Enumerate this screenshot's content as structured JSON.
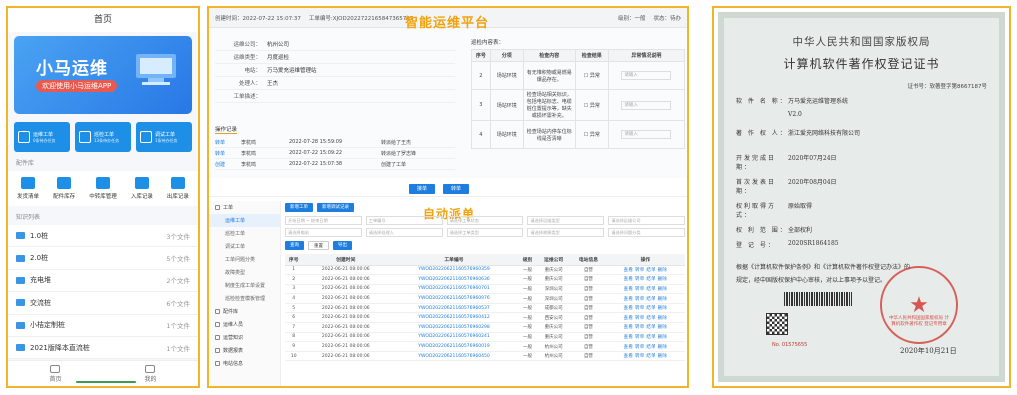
{
  "mobile": {
    "title": "首页",
    "banner_title": "小马运维",
    "banner_subtitle": "欢迎使用小马运维APP",
    "cards": [
      {
        "label": "运维工单",
        "sub": "0条待办任务"
      },
      {
        "label": "巡检工单",
        "sub": "13条待办任务"
      },
      {
        "label": "调试工单",
        "sub": "1条待办任务"
      }
    ],
    "section_parts": "配件库",
    "icons": [
      {
        "label": "发货清单"
      },
      {
        "label": "配件库存"
      },
      {
        "label": "中转库管理"
      },
      {
        "label": "入库记录"
      },
      {
        "label": "出库记录"
      }
    ],
    "section_knowledge": "知识列表",
    "knowledge": [
      {
        "name": "1.0桩",
        "count": "3个文件"
      },
      {
        "name": "2.0桩",
        "count": "5个文件"
      },
      {
        "name": "充电堆",
        "count": "2个文件"
      },
      {
        "name": "交流桩",
        "count": "6个文件"
      },
      {
        "name": "小桔定制桩",
        "count": "1个文件"
      },
      {
        "name": "2021版降本直流桩",
        "count": "1个文件"
      }
    ],
    "tabs": [
      {
        "label": "首页"
      },
      {
        "label": "我的"
      }
    ]
  },
  "web": {
    "header": {
      "created": "创建时间：2022-07-22 15:07:37",
      "order_no": "工单编号:XJOD2022722165847365792",
      "level": "级别：一般",
      "status": "状态：待办"
    },
    "title": "智能运维平台",
    "form": [
      {
        "label": "运维公司：",
        "value": "杭州公司"
      },
      {
        "label": "运维类型：",
        "value": "月度巡检"
      },
      {
        "label": "电站：",
        "value": "万马爱充运维管理站"
      },
      {
        "label": "处理人：",
        "value": "王杰"
      },
      {
        "label": "工单描述：",
        "value": ""
      }
    ],
    "check_title": "巡检内容表：",
    "check_headers": [
      "序号",
      "分项",
      "检查内容",
      "检查结果",
      "异常情况说明"
    ],
    "check_rows": [
      {
        "no": "2",
        "item": "场站环境",
        "content": "有无堆积物或易燃易爆品存在。",
        "result": "异常",
        "note": "请输入"
      },
      {
        "no": "3",
        "item": "场站环境",
        "content": "检查场站相关标识，包括电站标志、电缆桩位置提示等，缺失或损坏需补充。",
        "result": "异常",
        "note": "请输入"
      },
      {
        "no": "4",
        "item": "场站环境",
        "content": "检查场站内停车位标线是否清晰",
        "result": "异常",
        "note": "请输入"
      }
    ],
    "oplog_title": "操作记录",
    "oplog": [
      {
        "action": "转单",
        "user": "李杭鸣",
        "time": "2022-07-28 15:59:09",
        "desc": "转派给了王杰"
      },
      {
        "action": "转单",
        "user": "李杭鸣",
        "time": "2022-07-22 15:09:22",
        "desc": "转派给了罗志锋"
      },
      {
        "action": "创建",
        "user": "李杭鸣",
        "time": "2022-07-22 15:07:38",
        "desc": "创建了工单"
      }
    ],
    "btn_receive": "接单",
    "btn_transfer": "转单",
    "title2": "自动派单",
    "sidebar": [
      {
        "label": "工单",
        "type": "top"
      },
      {
        "label": "运维工单",
        "type": "sub-active"
      },
      {
        "label": "巡检工单",
        "type": "sub"
      },
      {
        "label": "调试工单",
        "type": "sub"
      },
      {
        "label": "工单问题分类",
        "type": "sub"
      },
      {
        "label": "故障类型",
        "type": "sub"
      },
      {
        "label": "制度生成工单设置",
        "type": "sub"
      },
      {
        "label": "巡检检查模板管理",
        "type": "sub"
      },
      {
        "label": "配件库",
        "type": "top"
      },
      {
        "label": "运维人员",
        "type": "top"
      },
      {
        "label": "运营知识",
        "type": "top"
      },
      {
        "label": "数据报表",
        "type": "top"
      },
      {
        "label": "电站信息",
        "type": "top"
      }
    ],
    "toolbar": [
      "新增工单",
      "新增调试记录"
    ],
    "filters": [
      "开始日期 ~ 结束日期",
      "工单编号",
      "请选择工单状态",
      "请选择运维类型",
      "请选择运维公司",
      "请选择电站",
      "请选择处理人",
      "请选择工单类型",
      "请选择故障类型",
      "请选择问题分类"
    ],
    "action_buttons": [
      "查询",
      "重置",
      "导出"
    ],
    "grid_headers": [
      "序号",
      "创建时间",
      "工单编号",
      "级别",
      "运维公司",
      "电站信息",
      "操作"
    ],
    "grid_rows": [
      {
        "no": "1",
        "time": "2022-06-21 08:00:06",
        "order": "YWOD20220621160576960359",
        "level": "一般",
        "company": "重庆公司",
        "station": "自营",
        "ops": "查看 转单 结单 删除"
      },
      {
        "no": "2",
        "time": "2022-06-21 08:00:06",
        "order": "YWOD20220621160576960636",
        "level": "一般",
        "company": "重庆公司",
        "station": "自营",
        "ops": "查看 转单 结单 删除"
      },
      {
        "no": "3",
        "time": "2022-06-21 08:00:06",
        "order": "YWOD20220621160576960701",
        "level": "一般",
        "company": "深圳公司",
        "station": "自营",
        "ops": "查看 转单 结单 删除"
      },
      {
        "no": "4",
        "time": "2022-06-21 08:00:06",
        "order": "YWOD20220621160576960976",
        "level": "一般",
        "company": "深圳公司",
        "station": "自营",
        "ops": "查看 转单 结单 删除"
      },
      {
        "no": "5",
        "time": "2022-06-21 08:00:06",
        "order": "YWOD20220621160576960537",
        "level": "一般",
        "company": "成都公司",
        "station": "自营",
        "ops": "查看 转单 结单 删除"
      },
      {
        "no": "6",
        "time": "2022-06-21 08:00:06",
        "order": "YWOD20220621160576960412",
        "level": "一般",
        "company": "西安公司",
        "station": "自营",
        "ops": "查看 转单 结单 删除"
      },
      {
        "no": "7",
        "time": "2022-06-21 08:00:06",
        "order": "YWOD20220621160576960298",
        "level": "一般",
        "company": "重庆公司",
        "station": "自营",
        "ops": "查看 转单 结单 删除"
      },
      {
        "no": "8",
        "time": "2022-06-21 08:00:06",
        "order": "YWOD20220621160576960241",
        "level": "一般",
        "company": "重庆公司",
        "station": "自营",
        "ops": "查看 转单 结单 删除"
      },
      {
        "no": "9",
        "time": "2022-06-21 08:00:06",
        "order": "YWOD20220621160576960019",
        "level": "一般",
        "company": "杭州公司",
        "station": "自营",
        "ops": "查看 转单 结单 删除"
      },
      {
        "no": "10",
        "time": "2022-06-21 08:00:06",
        "order": "YWOD20220621160576960450",
        "level": "一般",
        "company": "杭州公司",
        "station": "自营",
        "ops": "查看 转单 结单 删除"
      }
    ]
  },
  "cert": {
    "title1": "中华人民共和国国家版权局",
    "title2": "计算机软件著作权登记证书",
    "cert_no": "证书号：软著登字第8667187号",
    "software_label": "软 件 名 称：",
    "software_name": "万马爱充运维管理系统",
    "version": "V2.0",
    "owner_label": "著 作 权 人：",
    "owner": "浙江爱充网络科技有限公司",
    "fields": [
      {
        "label": "开发完成日期：",
        "value": "2020年07月24日"
      },
      {
        "label": "首次发表日期：",
        "value": "2020年08月04日"
      },
      {
        "label": "权利取得方式：",
        "value": "原始取得"
      },
      {
        "label": "权 利 范 围：",
        "value": "全部权利"
      },
      {
        "label": "登 记 号：",
        "value": "2020SR1864185"
      }
    ],
    "para1": "根据《计算机软件保护条例》和《计算机软件著作权登记办法》的",
    "para2": "规定，经中国版权保护中心审核，对以上事项予以登记。",
    "serial": "No. 01575655",
    "seal_text": "中华人民共和国国家版权局 计算机软件著作权 登记专用章",
    "date": "2020年10月21日"
  }
}
